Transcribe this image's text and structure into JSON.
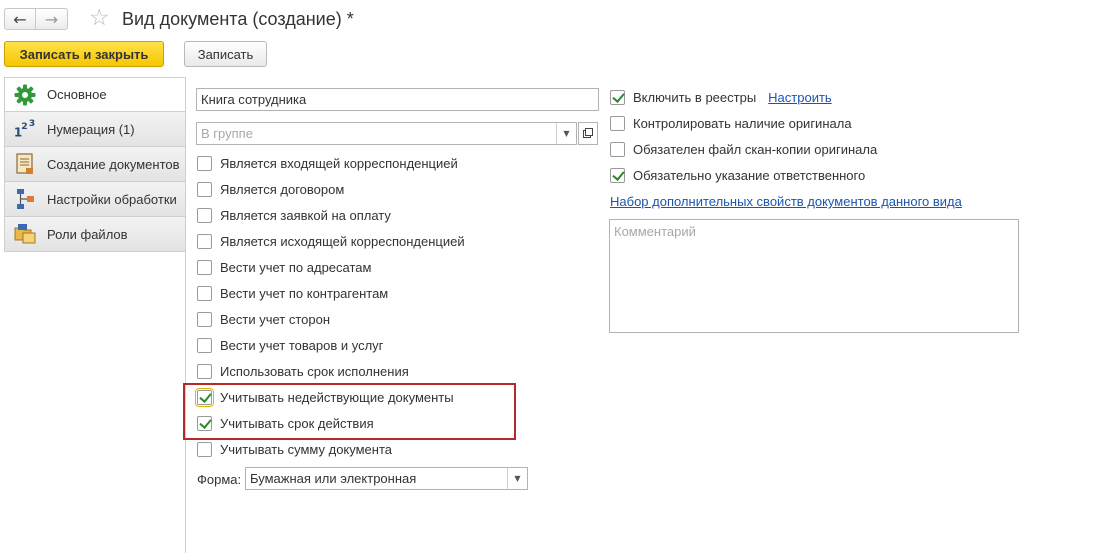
{
  "header": {
    "title": "Вид документа (создание) *"
  },
  "toolbar": {
    "save_close_label": "Записать и закрыть",
    "save_label": "Записать"
  },
  "tabs": [
    {
      "label": "Основное",
      "icon": "gear-icon",
      "active": true
    },
    {
      "label": "Нумерация (1)",
      "icon": "numbering-icon",
      "active": false
    },
    {
      "label": "Создание документов",
      "icon": "document-create-icon",
      "active": false
    },
    {
      "label": "Настройки обработки",
      "icon": "process-settings-icon",
      "active": false
    },
    {
      "label": "Роли файлов",
      "icon": "file-roles-icon",
      "active": false
    }
  ],
  "main": {
    "name_value": "Книга сотрудника",
    "group_placeholder": "В группе",
    "checkboxes": [
      {
        "label": "Является входящей корреспонденцией",
        "checked": false
      },
      {
        "label": "Является договором",
        "checked": false
      },
      {
        "label": "Является заявкой на оплату",
        "checked": false
      },
      {
        "label": "Является исходящей корреспонденцией",
        "checked": false
      },
      {
        "label": "Вести учет по адресатам",
        "checked": false
      },
      {
        "label": "Вести учет по контрагентам",
        "checked": false
      },
      {
        "label": "Вести учет сторон",
        "checked": false
      },
      {
        "label": "Вести учет товаров и услуг",
        "checked": false
      },
      {
        "label": "Использовать срок исполнения",
        "checked": false
      },
      {
        "label": "Учитывать недействующие документы",
        "checked": true
      },
      {
        "label": "Учитывать срок действия",
        "checked": true
      },
      {
        "label": "Учитывать сумму документа",
        "checked": false
      }
    ],
    "form_label": "Форма:",
    "form_value": "Бумажная или электронная"
  },
  "right": {
    "checkboxes": [
      {
        "label": "Включить в реестры",
        "checked": true
      },
      {
        "label": "Контролировать наличие оригинала",
        "checked": false
      },
      {
        "label": "Обязателен файл скан-копии оригинала",
        "checked": false
      },
      {
        "label": "Обязательно указание ответственного",
        "checked": true
      }
    ],
    "configure_link": "Настроить",
    "extra_props_link": "Набор дополнительных свойств документов данного вида",
    "comment_placeholder": "Комментарий"
  },
  "colors": {
    "primary_button": "#f5c600",
    "checkmark": "#2b8a2b",
    "highlight": "#b22a2a",
    "link": "#1a56b0"
  }
}
